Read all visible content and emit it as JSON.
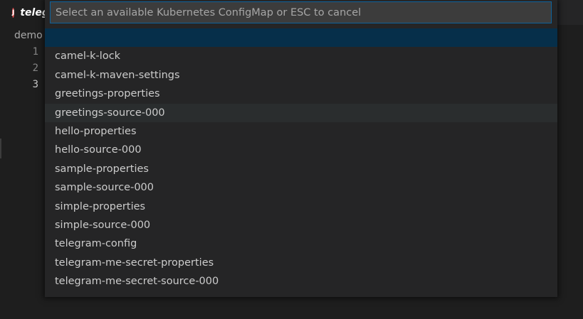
{
  "editor": {
    "tab": {
      "icon": "camel-k-j-icon",
      "label": "telegram"
    },
    "breadcrumb": "demo",
    "line_numbers": [
      "1",
      "2",
      "3"
    ],
    "active_line": 3
  },
  "quick_pick": {
    "placeholder": "Select an available Kubernetes ConfigMap or ESC to cancel",
    "value": "",
    "items": [
      {
        "label": "",
        "state": "selected"
      },
      {
        "label": "camel-k-lock",
        "state": ""
      },
      {
        "label": "camel-k-maven-settings",
        "state": ""
      },
      {
        "label": "greetings-properties",
        "state": ""
      },
      {
        "label": "greetings-source-000",
        "state": "hovered"
      },
      {
        "label": "hello-properties",
        "state": ""
      },
      {
        "label": "hello-source-000",
        "state": ""
      },
      {
        "label": "sample-properties",
        "state": ""
      },
      {
        "label": "sample-source-000",
        "state": ""
      },
      {
        "label": "simple-properties",
        "state": ""
      },
      {
        "label": "simple-source-000",
        "state": ""
      },
      {
        "label": "telegram-config",
        "state": ""
      },
      {
        "label": "telegram-me-secret-properties",
        "state": ""
      },
      {
        "label": "telegram-me-secret-source-000",
        "state": ""
      }
    ]
  },
  "colors": {
    "focus_border": "#0e639c",
    "selected_row": "#062f4a",
    "hovered_row": "#2a2d2e",
    "icon_red": "#e04b4b"
  }
}
